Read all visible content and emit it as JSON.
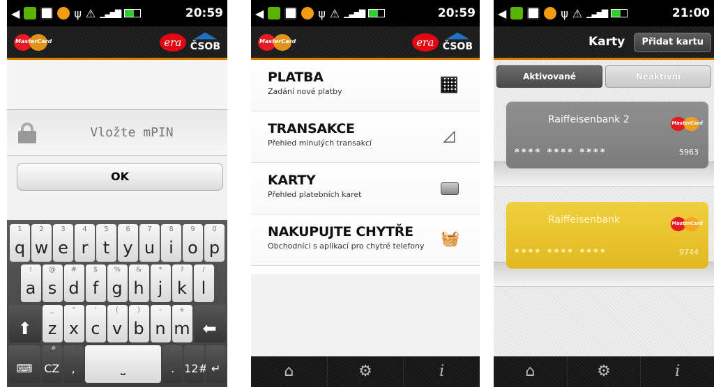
{
  "phone1": {
    "status_time": "20:59",
    "pin_placeholder": "Vložte mPIN",
    "ok_label": "OK",
    "keyboard": {
      "row1": [
        [
          "1",
          "q"
        ],
        [
          "2",
          "w"
        ],
        [
          "3",
          "e"
        ],
        [
          "4",
          "r"
        ],
        [
          "5",
          "t"
        ],
        [
          "6",
          "y"
        ],
        [
          "7",
          "u"
        ],
        [
          "8",
          "i"
        ],
        [
          "9",
          "o"
        ],
        [
          "0",
          "p"
        ]
      ],
      "row2": [
        [
          "!",
          "a"
        ],
        [
          "@",
          "s"
        ],
        [
          "#",
          "d"
        ],
        [
          "$",
          "f"
        ],
        [
          "%",
          "g"
        ],
        [
          "&",
          "h"
        ],
        [
          "*",
          "j"
        ],
        [
          "?",
          "k"
        ],
        [
          "/",
          "l"
        ]
      ],
      "row3": [
        [
          "_",
          "z"
        ],
        [
          "\"",
          "x"
        ],
        [
          "'",
          "c"
        ],
        [
          "(",
          "v"
        ],
        [
          ")",
          "b"
        ],
        [
          "-",
          "n"
        ],
        [
          "+",
          "m"
        ]
      ],
      "lang_label": "CZ",
      "sym_label": "12#"
    }
  },
  "phone2": {
    "status_time": "20:59",
    "menu": [
      {
        "title": "PLATBA",
        "subtitle": "Zadání nové platby",
        "icon": "qr-code-icon"
      },
      {
        "title": "TRANSAKCE",
        "subtitle": "Přehled minulých transakcí",
        "icon": "receipt-icon"
      },
      {
        "title": "KARTY",
        "subtitle": "Přehled platebních karet",
        "icon": "credit-card-icon"
      },
      {
        "title": "NAKUPUJTE CHYTŘE",
        "subtitle": "Obchodníci s aplikací pro chytré telefony",
        "icon": "basket-icon"
      }
    ]
  },
  "phone3": {
    "status_time": "21:00",
    "title": "Karty",
    "add_button": "Přidat kartu",
    "tab_active": "Aktivované",
    "tab_inactive": "Neaktivní",
    "cards": [
      {
        "bank": "Raiffeisenbank 2",
        "masked": "****   ****   ****",
        "last4": "5963",
        "color": "#8a8a8a"
      },
      {
        "bank": "Raiffeisenbank",
        "masked": "****   ****   ****",
        "last4": "9744",
        "color": "#e8c22c"
      }
    ]
  },
  "brand": {
    "mastercard": "MasterCard",
    "era": "era",
    "csob": "ČSOB",
    "accent": "#e07b00"
  }
}
